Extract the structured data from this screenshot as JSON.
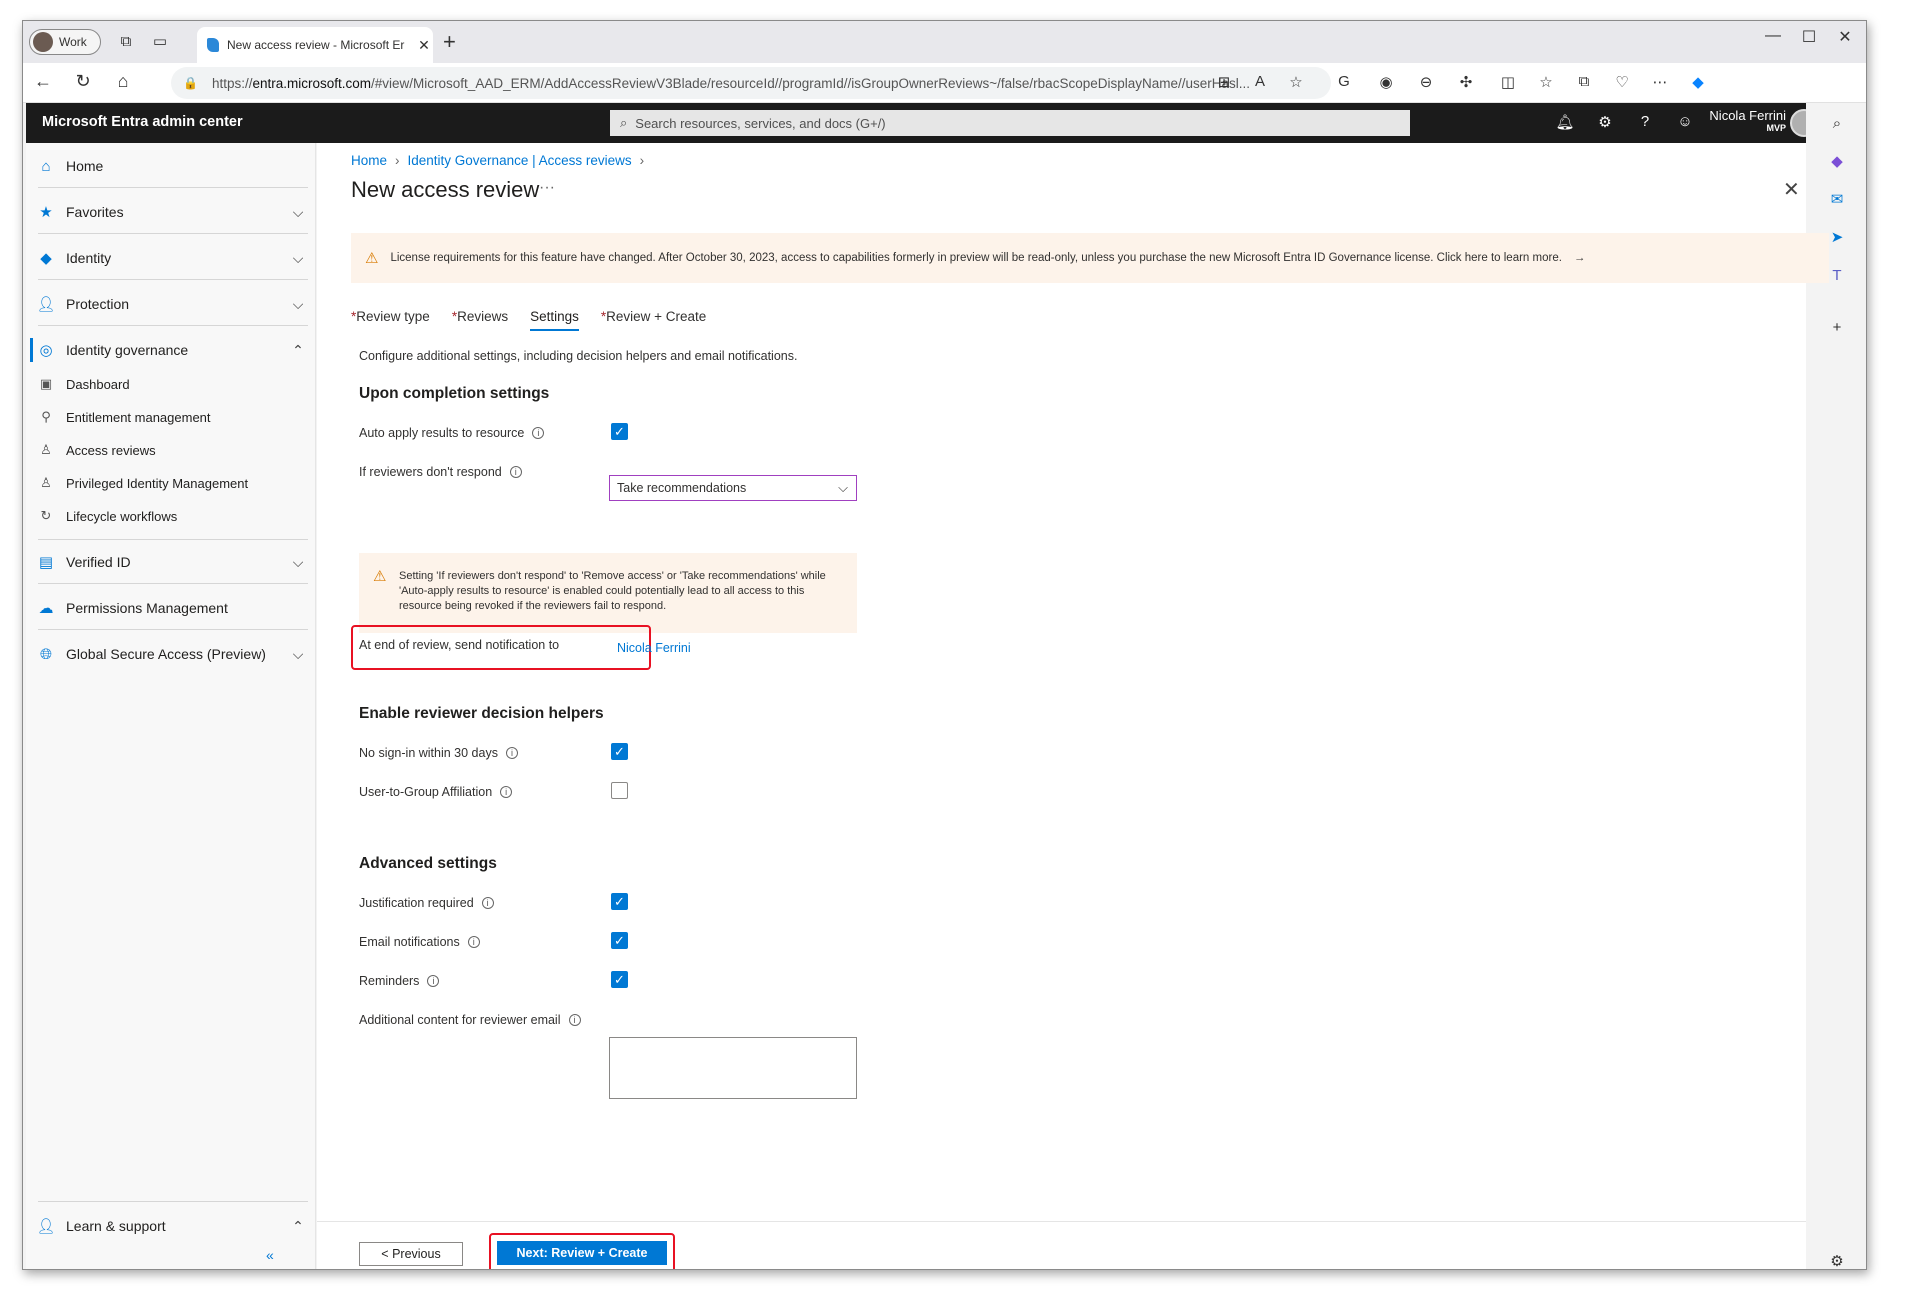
{
  "browser": {
    "profile_label": "Work",
    "tab_title": "New access review - Microsoft Er",
    "url_prefix": "https://",
    "url_host": "entra.microsoft.com",
    "url_path": "/#view/Microsoft_AAD_ERM/AddAccessReviewV3Blade/resourceId//programId//isGroupOwnerReviews~/false/rbacScopeDisplayName//userHasl..."
  },
  "header": {
    "brand": "Microsoft Entra admin center",
    "search_placeholder": "Search resources, services, and docs (G+/)",
    "user_name": "Nicola Ferrini",
    "user_role": "MVP"
  },
  "nav": {
    "home": "Home",
    "favorites": "Favorites",
    "identity": "Identity",
    "protection": "Protection",
    "identity_governance": "Identity governance",
    "sub": {
      "dashboard": "Dashboard",
      "entitlement": "Entitlement management",
      "access_reviews": "Access reviews",
      "pim": "Privileged Identity Management",
      "lifecycle": "Lifecycle workflows"
    },
    "verified_id": "Verified ID",
    "permissions": "Permissions Management",
    "gsa": "Global Secure Access (Preview)",
    "learn": "Learn & support"
  },
  "page": {
    "breadcrumb": [
      "Home",
      "Identity Governance | Access reviews"
    ],
    "title": "New access review",
    "banner": "License requirements for this feature have changed. After October 30, 2023, access to capabilities formerly in preview will be read-only, unless you purchase the new Microsoft Entra ID Governance license. Click here to learn more.",
    "tabs": [
      "Review type",
      "Reviews",
      "Settings",
      "Review + Create"
    ],
    "description": "Configure additional settings, including decision helpers and email notifications.",
    "completion_heading": "Upon completion settings",
    "auto_apply_label": "Auto apply results to resource",
    "if_no_respond_label": "If reviewers don't respond",
    "if_no_respond_value": "Take recommendations",
    "warning_text": "Setting 'If reviewers don't respond' to 'Remove access' or 'Take recommendations' while 'Auto-apply results to resource' is enabled could potentially lead to all access to this resource being revoked if the reviewers fail to respond.",
    "notify_label": "At end of review, send notification to",
    "notify_value": "Nicola Ferrini",
    "helpers_heading": "Enable reviewer decision helpers",
    "no_signin_label": "No sign-in within 30 days",
    "affiliation_label": "User-to-Group Affiliation",
    "advanced_heading": "Advanced settings",
    "justification_label": "Justification required",
    "email_label": "Email notifications",
    "reminders_label": "Reminders",
    "additional_label": "Additional content for reviewer email",
    "prev_button": "< Previous",
    "next_button": "Next: Review + Create"
  },
  "checkboxes": {
    "auto_apply": true,
    "no_signin": true,
    "affiliation": false,
    "justification": true,
    "email": true,
    "reminders": true
  },
  "colors": {
    "accent": "#0078d4",
    "highlight": "#e81123",
    "warning": "#d87a00"
  }
}
